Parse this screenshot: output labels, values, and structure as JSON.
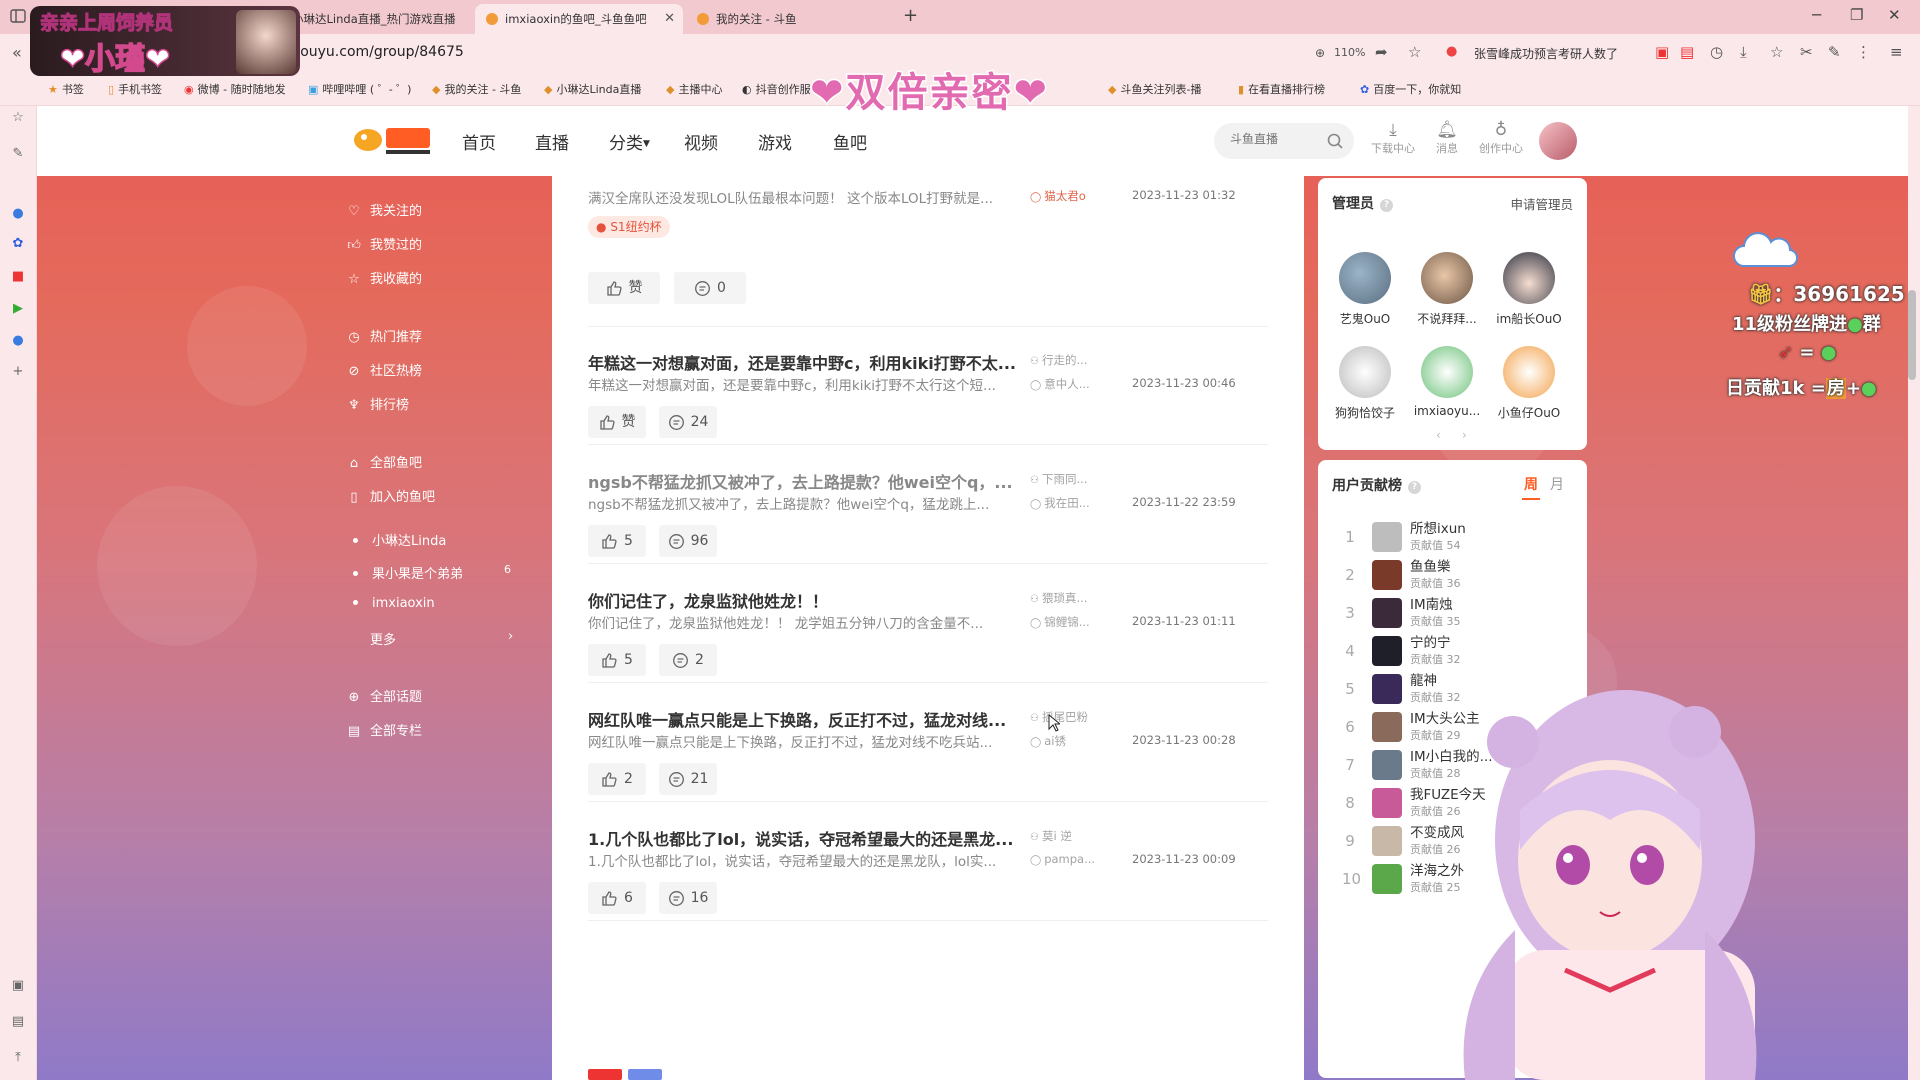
{
  "browser": {
    "tabs": [
      {
        "title": "小琳达Linda直播_热门游戏直播",
        "active": false
      },
      {
        "title": "imxiaoxin的鱼吧_斗鱼鱼吧",
        "active": true
      },
      {
        "title": "我的关注 - 斗鱼",
        "active": false
      }
    ],
    "url": "n.douyu.com/group/84675",
    "zoom": "110%",
    "search_suggestion": "张雪峰成功预言考研人数了",
    "bookmarks": [
      "书签",
      "手机书签",
      "微博 - 随时随地发",
      "哔哩哔哩 ( ゜- ゜)",
      "我的关注 - 斗鱼",
      "小琳达Linda直播",
      "主播中心",
      "抖音创作服",
      "斗鱼关注列表-播",
      "在看直播排行榜",
      "百度一下，你就知"
    ]
  },
  "nav": {
    "items": [
      "首页",
      "直播",
      "分类",
      "视频",
      "游戏",
      "鱼吧"
    ],
    "search_placeholder": "斗鱼直播",
    "icons": [
      {
        "label": "下载中心",
        "icon": "download-icon"
      },
      {
        "label": "消息",
        "icon": "bell-icon"
      },
      {
        "label": "创作中心",
        "icon": "bulb-icon"
      }
    ]
  },
  "sidebar": {
    "group1": [
      "我关注的",
      "我赞过的",
      "我收藏的"
    ],
    "group2": [
      "热门推荐",
      "社区热榜",
      "排行榜"
    ],
    "group3": [
      "全部鱼吧",
      "加入的鱼吧"
    ],
    "joined": [
      {
        "label": "小琳达Linda",
        "count": ""
      },
      {
        "label": "果小果是个弟弟",
        "count": "6"
      },
      {
        "label": "imxiaoxin",
        "count": ""
      }
    ],
    "more": "更多",
    "group4": [
      "全部话题",
      "全部专栏"
    ]
  },
  "feed": {
    "first_excerpt": "满汉全席队还没发现LOL队伍最根本问题！ 这个版本LOL打野就是...",
    "first_author": "猫太君o",
    "first_time": "2023-11-23 01:32",
    "first_tag": "S1纽约杯",
    "first_like": "赞",
    "first_comments": "0",
    "posts": [
      {
        "title": "年糕这一对想赢对面，还是要靠中野c，利用kiki打野不太...",
        "excerpt": "年糕这一对想赢对面，还是要靠中野c，利用kiki打野不太行这个短...",
        "meta1": "行走的...",
        "meta2": "意中人...",
        "time": "2023-11-23 00:46",
        "likes": "赞",
        "comments": "24"
      },
      {
        "title": "ngsb不帮猛龙抓又被冲了，去上路提款？他wei空个q，...",
        "excerpt": "ngsb不帮猛龙抓又被冲了，去上路提款？他wei空个q，猛龙跳上...",
        "meta1": "下雨同...",
        "meta2": "我在田...",
        "time": "2023-11-22 23:59",
        "likes": "5",
        "comments": "96"
      },
      {
        "title": "你们记住了，龙泉监狱他姓龙！！",
        "excerpt": "你们记住了，龙泉监狱他姓龙！！ 龙学姐五分钟八刀的含金量不...",
        "meta1": "猥琐真...",
        "meta2": "锦鲤锦...",
        "time": "2023-11-23 01:11",
        "likes": "5",
        "comments": "2"
      },
      {
        "title": "网红队唯一赢点只能是上下换路，反正打不过，猛龙对线...",
        "excerpt": "网红队唯一赢点只能是上下换路，反正打不过，猛龙对线不吃兵站...",
        "meta1": "摇尾巴粉",
        "meta2": "ai锈",
        "time": "2023-11-23 00:28",
        "likes": "2",
        "comments": "21"
      },
      {
        "title": "1.几个队也都比了lol，说实话，夺冠希望最大的还是黑龙...",
        "excerpt": "1.几个队也都比了lol，说实话，夺冠希望最大的还是黑龙队，lol实...",
        "meta1": "莫i 逆",
        "meta2": "pampa...",
        "time": "2023-11-23 00:09",
        "likes": "6",
        "comments": "16"
      }
    ]
  },
  "admins": {
    "title": "管理员",
    "apply": "申请管理员",
    "list": [
      "艺鬼OuO",
      "不说拜拜...",
      "im船长OuO",
      "狗狗恰饺子",
      "imxiaoyu...",
      "小鱼仔OuO"
    ]
  },
  "ranking": {
    "title": "用户贡献榜",
    "tabs": [
      "周",
      "月"
    ],
    "value_label": "贡献值",
    "rows": [
      {
        "rank": "1",
        "name": "所想ixun",
        "value": "54"
      },
      {
        "rank": "2",
        "name": "鱼鱼樂",
        "value": "36"
      },
      {
        "rank": "3",
        "name": "IM南烛",
        "value": "35"
      },
      {
        "rank": "4",
        "name": "宁的宁",
        "value": "32"
      },
      {
        "rank": "5",
        "name": "龍神",
        "value": "32"
      },
      {
        "rank": "6",
        "name": "IM大头公主",
        "value": "29"
      },
      {
        "rank": "7",
        "name": "IM小白我的...",
        "value": "28"
      },
      {
        "rank": "8",
        "name": "我FUZE今天",
        "value": "26"
      },
      {
        "rank": "9",
        "name": "不变成风",
        "value": "26"
      },
      {
        "rank": "10",
        "name": "洋海之外",
        "value": "25"
      }
    ]
  },
  "overlay": {
    "top_left_line1": "亲亲上周饲养员",
    "top_left_name": "❤小瑾❤",
    "center_banner": "❤双倍亲密❤",
    "right_count": "：36961625",
    "right_line2": "11级粉丝牌进",
    "right_line2_suffix": "群",
    "right_line4": "日贡献1k =",
    "right_line4_fang": "房",
    "right_line4_plus": "+"
  },
  "colors": {
    "accent": "#ff5d23",
    "tag_bg": "#fde9e2",
    "tag_text": "#e5533d"
  }
}
